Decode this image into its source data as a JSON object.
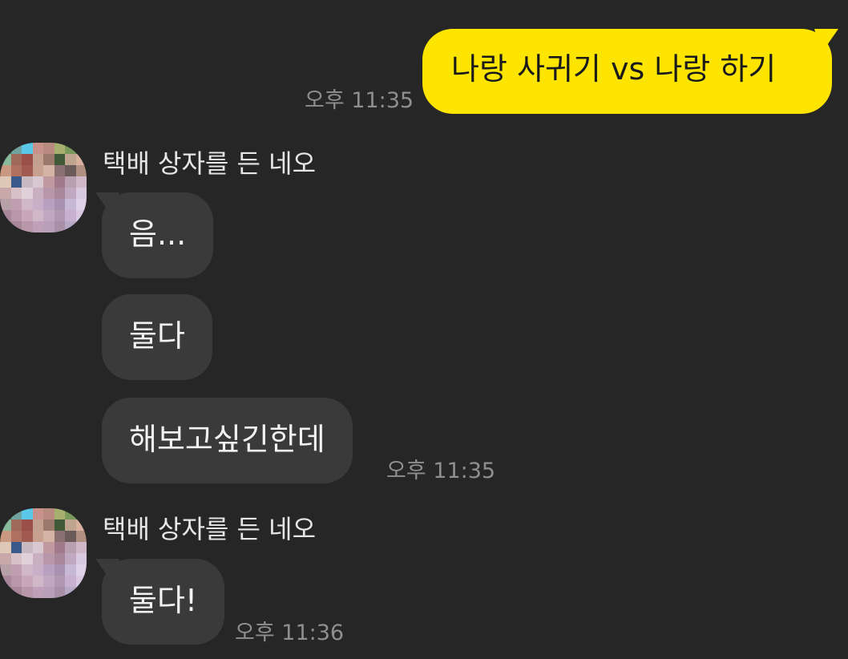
{
  "outgoing": [
    {
      "text": "나랑 사귀기 vs 나랑 하기",
      "time": "오후 11:35"
    }
  ],
  "groups": [
    {
      "sender": "택배 상자를 든 네오",
      "messages": [
        "음...",
        "둘다",
        "해보고싶긴한데"
      ],
      "time": "오후 11:35"
    },
    {
      "sender": "택배 상자를 든 네오",
      "messages": [
        "둘다!"
      ],
      "time": "오후 11:36"
    }
  ],
  "colors": {
    "background": "#262626",
    "outgoing_bubble": "#fee500",
    "incoming_bubble": "#3a3a3a",
    "timestamp": "#8f8f8f"
  },
  "avatar_icon": "pixelated-profile-avatar"
}
